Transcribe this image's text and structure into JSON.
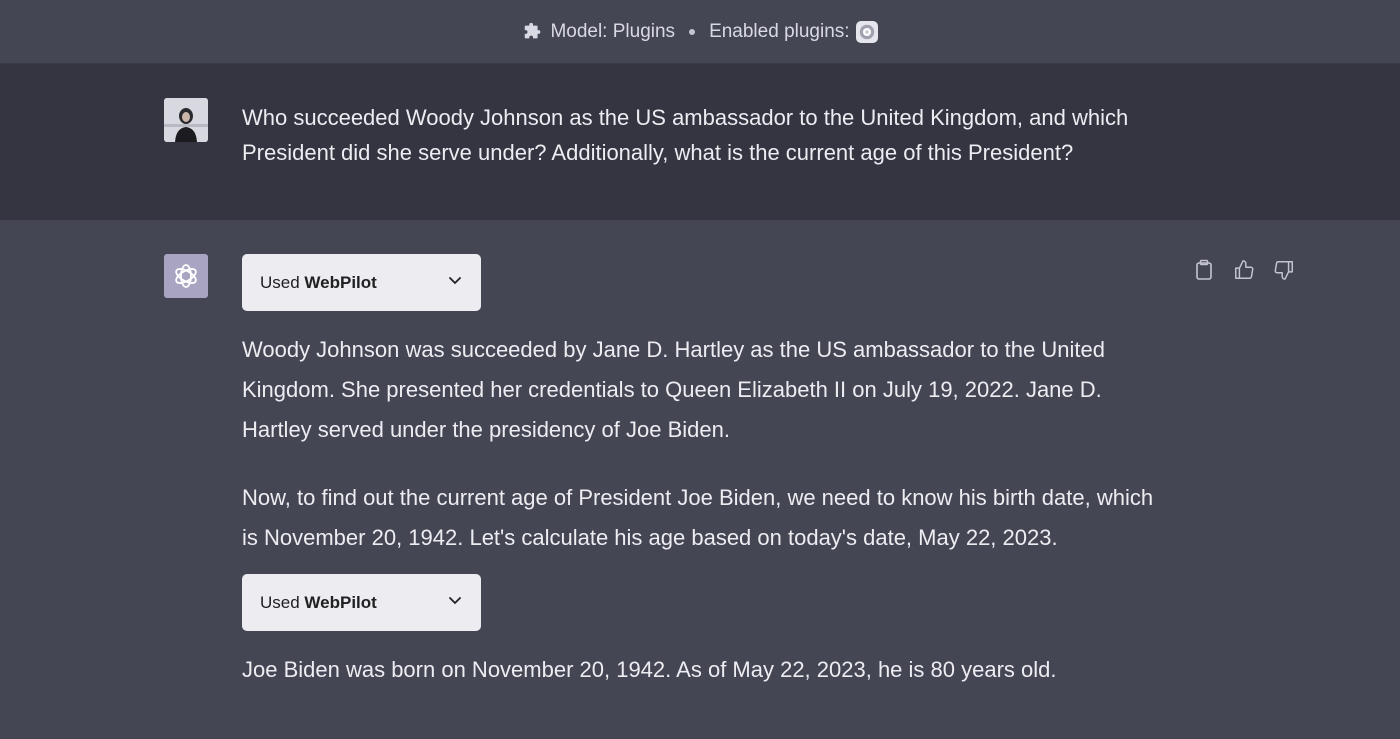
{
  "header": {
    "model_label": "Model: Plugins",
    "plugins_label": "Enabled plugins:"
  },
  "user_message": {
    "text": "Who succeeded Woody Johnson as the US ambassador to the United Kingdom, and which President did she serve under? Additionally, what is the current age of this President?"
  },
  "assistant_message": {
    "plugin_calls": [
      {
        "prefix": "Used",
        "name": "WebPilot"
      },
      {
        "prefix": "Used",
        "name": "WebPilot"
      }
    ],
    "paragraphs": [
      "Woody Johnson was succeeded by Jane D. Hartley as the US ambassador to the United Kingdom. She presented her credentials to Queen Elizabeth II on July 19, 2022. Jane D. Hartley served under the presidency of Joe Biden.",
      "Now, to find out the current age of President Joe Biden, we need to know his birth date, which is November 20, 1942. Let's calculate his age based on today's date, May 22, 2023.",
      "Joe Biden was born on November 20, 1942. As of May 22, 2023, he is 80 years old."
    ]
  },
  "icons": {
    "header": [
      "puzzle-icon",
      "plugin-logo-icon"
    ],
    "actions": [
      "clipboard-icon",
      "thumbs-up-icon",
      "thumbs-down-icon"
    ],
    "pill": "chevron-down-icon"
  },
  "colors": {
    "page_bg": "#444654",
    "user_row_bg": "#343541",
    "pill_bg": "#ececf1",
    "text": "#ececf1"
  }
}
